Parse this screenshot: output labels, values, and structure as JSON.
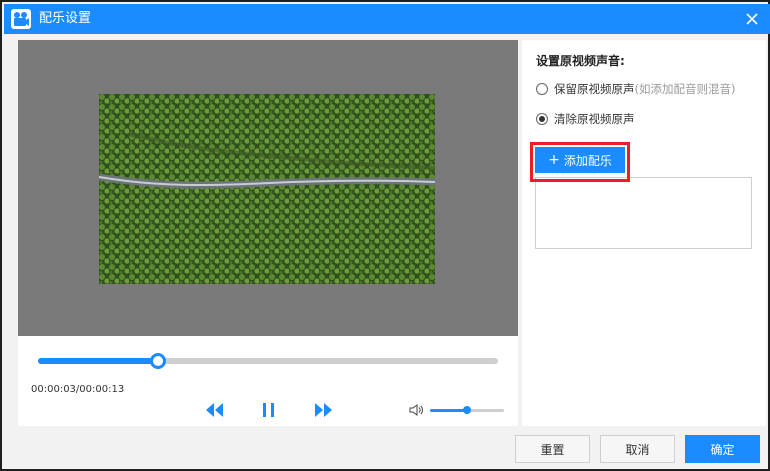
{
  "window": {
    "title": "配乐设置",
    "app_icon": "video-music-app-icon",
    "close_icon": "close-icon",
    "accent_color": "#1a8cff"
  },
  "player": {
    "current_time": "00:00:03/00:00:13",
    "progress_fraction": 0.26,
    "volume_fraction": 0.5,
    "controls": {
      "rewind_icon": "rewind-icon",
      "pause_icon": "pause-icon",
      "forward_icon": "fast-forward-icon",
      "volume_icon": "volume-icon"
    },
    "preview_image": "aerial view of a road through a dense forest"
  },
  "audio_settings": {
    "heading": "设置原视频声音:",
    "options": [
      {
        "label": "保留原视频原声",
        "hint": "(如添加配音则混音)",
        "checked": false
      },
      {
        "label": "清除原视频原声",
        "hint": "",
        "checked": true
      }
    ],
    "add_music_label": "添加配乐",
    "highlight_color": "#ee1c25"
  },
  "footer": {
    "reset_label": "重置",
    "cancel_label": "取消",
    "confirm_label": "确定"
  }
}
